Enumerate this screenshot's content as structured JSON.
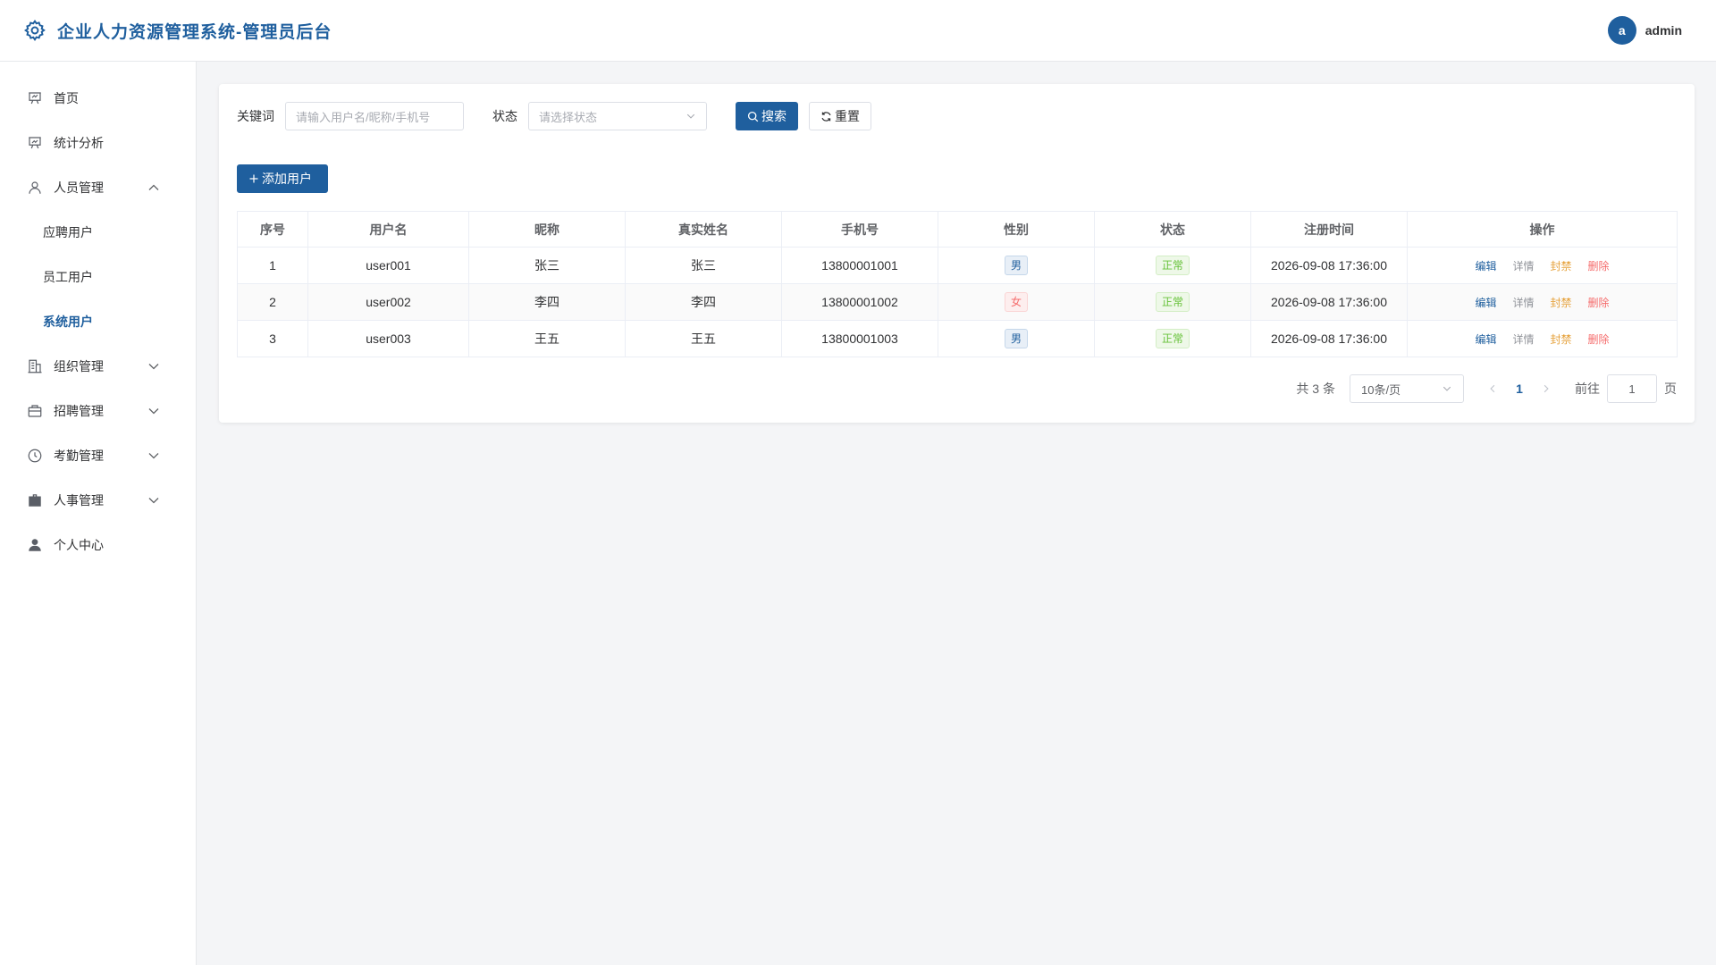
{
  "header": {
    "title": "企业人力资源管理系统-管理员后台",
    "avatar_letter": "a",
    "username": "admin"
  },
  "sidebar": {
    "items": [
      {
        "label": "首页",
        "icon": "presentation-icon"
      },
      {
        "label": "统计分析",
        "icon": "chart-board-icon"
      },
      {
        "label": "人员管理",
        "icon": "user-icon",
        "expanded": true,
        "children": [
          {
            "label": "应聘用户"
          },
          {
            "label": "员工用户"
          },
          {
            "label": "系统用户",
            "active": true
          }
        ]
      },
      {
        "label": "组织管理",
        "icon": "office-building-icon",
        "expanded": false
      },
      {
        "label": "招聘管理",
        "icon": "briefcase-icon",
        "expanded": false
      },
      {
        "label": "考勤管理",
        "icon": "clock-icon",
        "expanded": false
      },
      {
        "label": "人事管理",
        "icon": "suitcase-icon",
        "expanded": false
      },
      {
        "label": "个人中心",
        "icon": "user-filled-icon"
      }
    ]
  },
  "filter": {
    "keyword_label": "关键词",
    "keyword_placeholder": "请输入用户名/昵称/手机号",
    "status_label": "状态",
    "status_placeholder": "请选择状态",
    "search_label": "搜索",
    "reset_label": "重置"
  },
  "toolbar": {
    "add_label": "添加用户"
  },
  "table": {
    "columns": [
      "序号",
      "用户名",
      "昵称",
      "真实姓名",
      "手机号",
      "性别",
      "状态",
      "注册时间",
      "操作"
    ],
    "rows": [
      {
        "index": "1",
        "username": "user001",
        "nickname": "张三",
        "realname": "张三",
        "phone": "13800001001",
        "gender": "男",
        "status": "正常",
        "registered": "2026-09-08 17:36:00"
      },
      {
        "index": "2",
        "username": "user002",
        "nickname": "李四",
        "realname": "李四",
        "phone": "13800001002",
        "gender": "女",
        "status": "正常",
        "registered": "2026-09-08 17:36:00"
      },
      {
        "index": "3",
        "username": "user003",
        "nickname": "王五",
        "realname": "王五",
        "phone": "13800001003",
        "gender": "男",
        "status": "正常",
        "registered": "2026-09-08 17:36:00"
      }
    ],
    "actions": {
      "edit": "编辑",
      "detail": "详情",
      "ban": "封禁",
      "delete": "删除"
    }
  },
  "pagination": {
    "total_text": "共 3 条",
    "page_size": "10条/页",
    "current_page": "1",
    "goto_label": "前往",
    "goto_value": "1",
    "page_suffix": "页"
  },
  "colors": {
    "primary": "#1f5f9e",
    "danger": "#f56c6c",
    "warning": "#e6a23c",
    "success": "#67c23a"
  }
}
